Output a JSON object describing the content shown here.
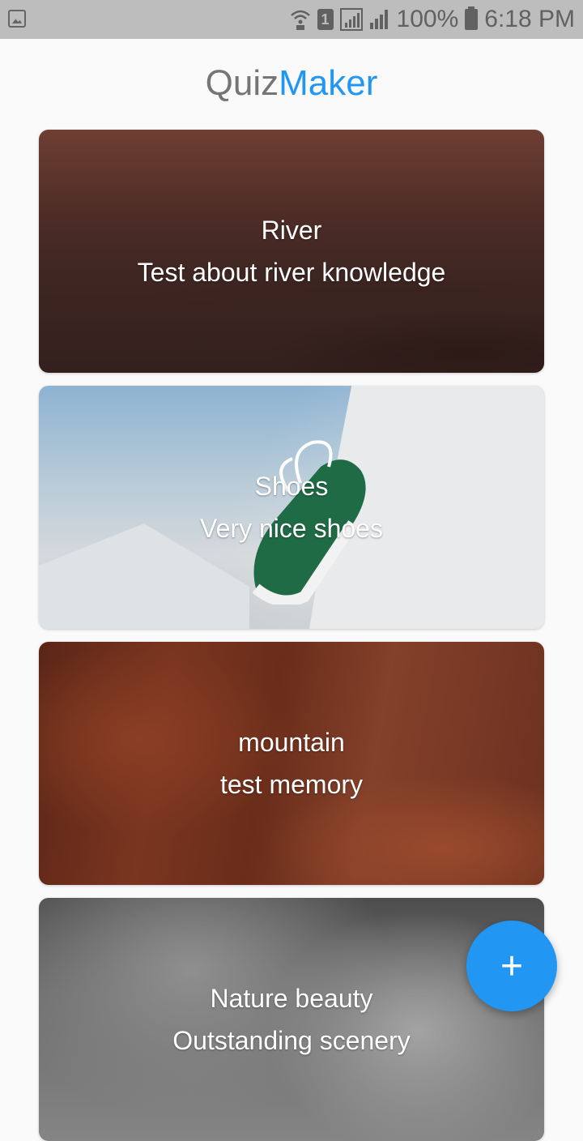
{
  "status_bar": {
    "battery_percent": "100%",
    "time": "6:18 PM",
    "sim_badge": "1",
    "icons": [
      "gallery-notification-icon",
      "wifi-call-icon",
      "sim-1-icon",
      "signal-icon",
      "signal-icon",
      "battery-icon"
    ]
  },
  "app_title": {
    "part1": "Quiz",
    "part2": "Maker",
    "accent_color": "#2196f3",
    "muted_color": "#757575"
  },
  "quizzes": [
    {
      "title": "River",
      "subtitle": "Test about river knowledge"
    },
    {
      "title": "Shoes",
      "subtitle": "Very nice shoes"
    },
    {
      "title": "mountain",
      "subtitle": "test memory"
    },
    {
      "title": "Nature beauty",
      "subtitle": "Outstanding scenery"
    }
  ],
  "fab": {
    "label": "+",
    "icon": "plus-icon",
    "color": "#2196f3"
  }
}
